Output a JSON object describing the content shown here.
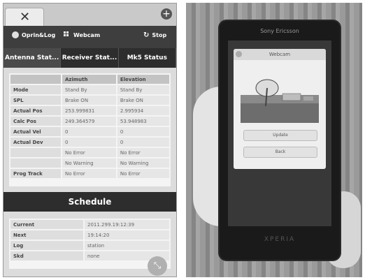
{
  "app": {
    "toolbar": {
      "opsLog": "Oprin&Log",
      "webcam": "Webcam",
      "stop": "Stop"
    },
    "tabs": [
      "Antenna Stat...",
      "Receiver Stat...",
      "Mk5 Status"
    ],
    "antenna_table": {
      "headers": [
        "",
        "Azimuth",
        "Elevation"
      ],
      "rows": [
        {
          "label": "Mode",
          "az": "Stand By",
          "el": "Stand By"
        },
        {
          "label": "SPL",
          "az": "Brake ON",
          "el": "Brake ON"
        },
        {
          "label": "Actual Pos",
          "az": "253.999831",
          "el": "2.995934"
        },
        {
          "label": "Calc Pos",
          "az": "249.364579",
          "el": "53.948983"
        },
        {
          "label": "Actual Vel",
          "az": "0",
          "el": "0"
        },
        {
          "label": "Actual Dev",
          "az": "0",
          "el": "0"
        },
        {
          "label": "",
          "az": "No Error",
          "el": "No Error"
        },
        {
          "label": "",
          "az": "No Warning",
          "el": "No Warning"
        },
        {
          "label": "Prog Track",
          "az": "No Error",
          "el": "No Error"
        }
      ]
    },
    "schedule": {
      "title": "Schedule",
      "rows": [
        {
          "label": "Current",
          "value": "2011.299.19:12:39"
        },
        {
          "label": "Next",
          "value": "19:14:20"
        },
        {
          "label": "Log",
          "value": "station"
        },
        {
          "label": "Skd",
          "value": "none"
        }
      ]
    }
  },
  "phone": {
    "brand": "Sony Ericsson",
    "dialog_title": "Webcam",
    "update_button": "Update",
    "back_button": "Back",
    "model": "XPERIA"
  }
}
